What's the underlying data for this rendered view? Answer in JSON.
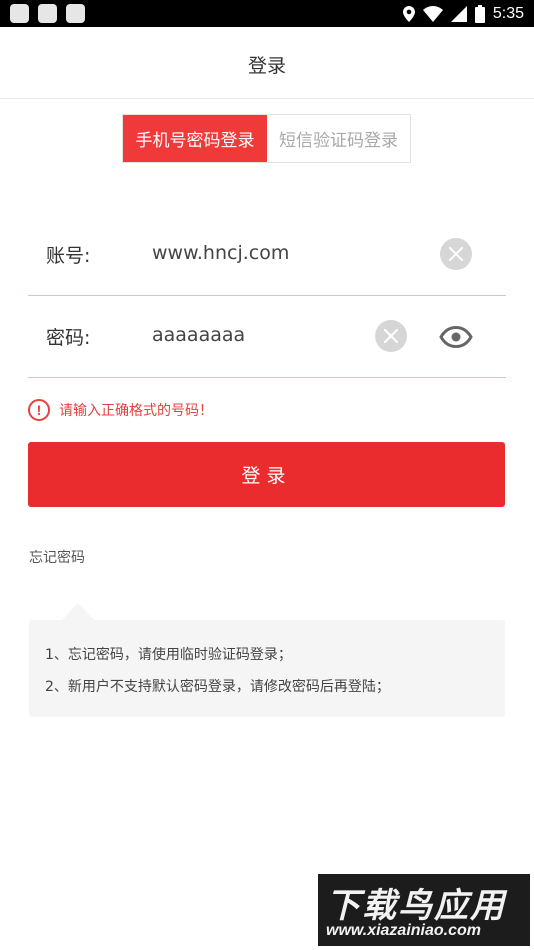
{
  "status_bar": {
    "time": "5:35",
    "icons": [
      "location-icon",
      "wifi-icon",
      "signal-icon",
      "battery-icon"
    ]
  },
  "header": {
    "title": "登录"
  },
  "tabs": [
    {
      "label": "手机号密码登录",
      "active": true
    },
    {
      "label": "短信验证码登录",
      "active": false
    }
  ],
  "account": {
    "label": "账号:",
    "value": "www.hncj.com"
  },
  "password": {
    "label": "密码:",
    "value": "aaaaaaaa"
  },
  "error": {
    "icon_text": "!",
    "text": "请输入正确格式的号码！"
  },
  "login_button": {
    "label": "登录"
  },
  "forgot_link": {
    "label": "忘记密码"
  },
  "tips": [
    "1、忘记密码，请使用临时验证码登录；",
    "2、新用户不支持默认密码登录，请修改密码后再登陆；"
  ],
  "watermark": {
    "title": "下载鸟应用",
    "url": "www.xiazainiao.com"
  },
  "colors": {
    "accent": "#ea2c2e",
    "tab_active": "#f03a3a",
    "divider": "#f0b8c4",
    "error": "#e84040"
  }
}
